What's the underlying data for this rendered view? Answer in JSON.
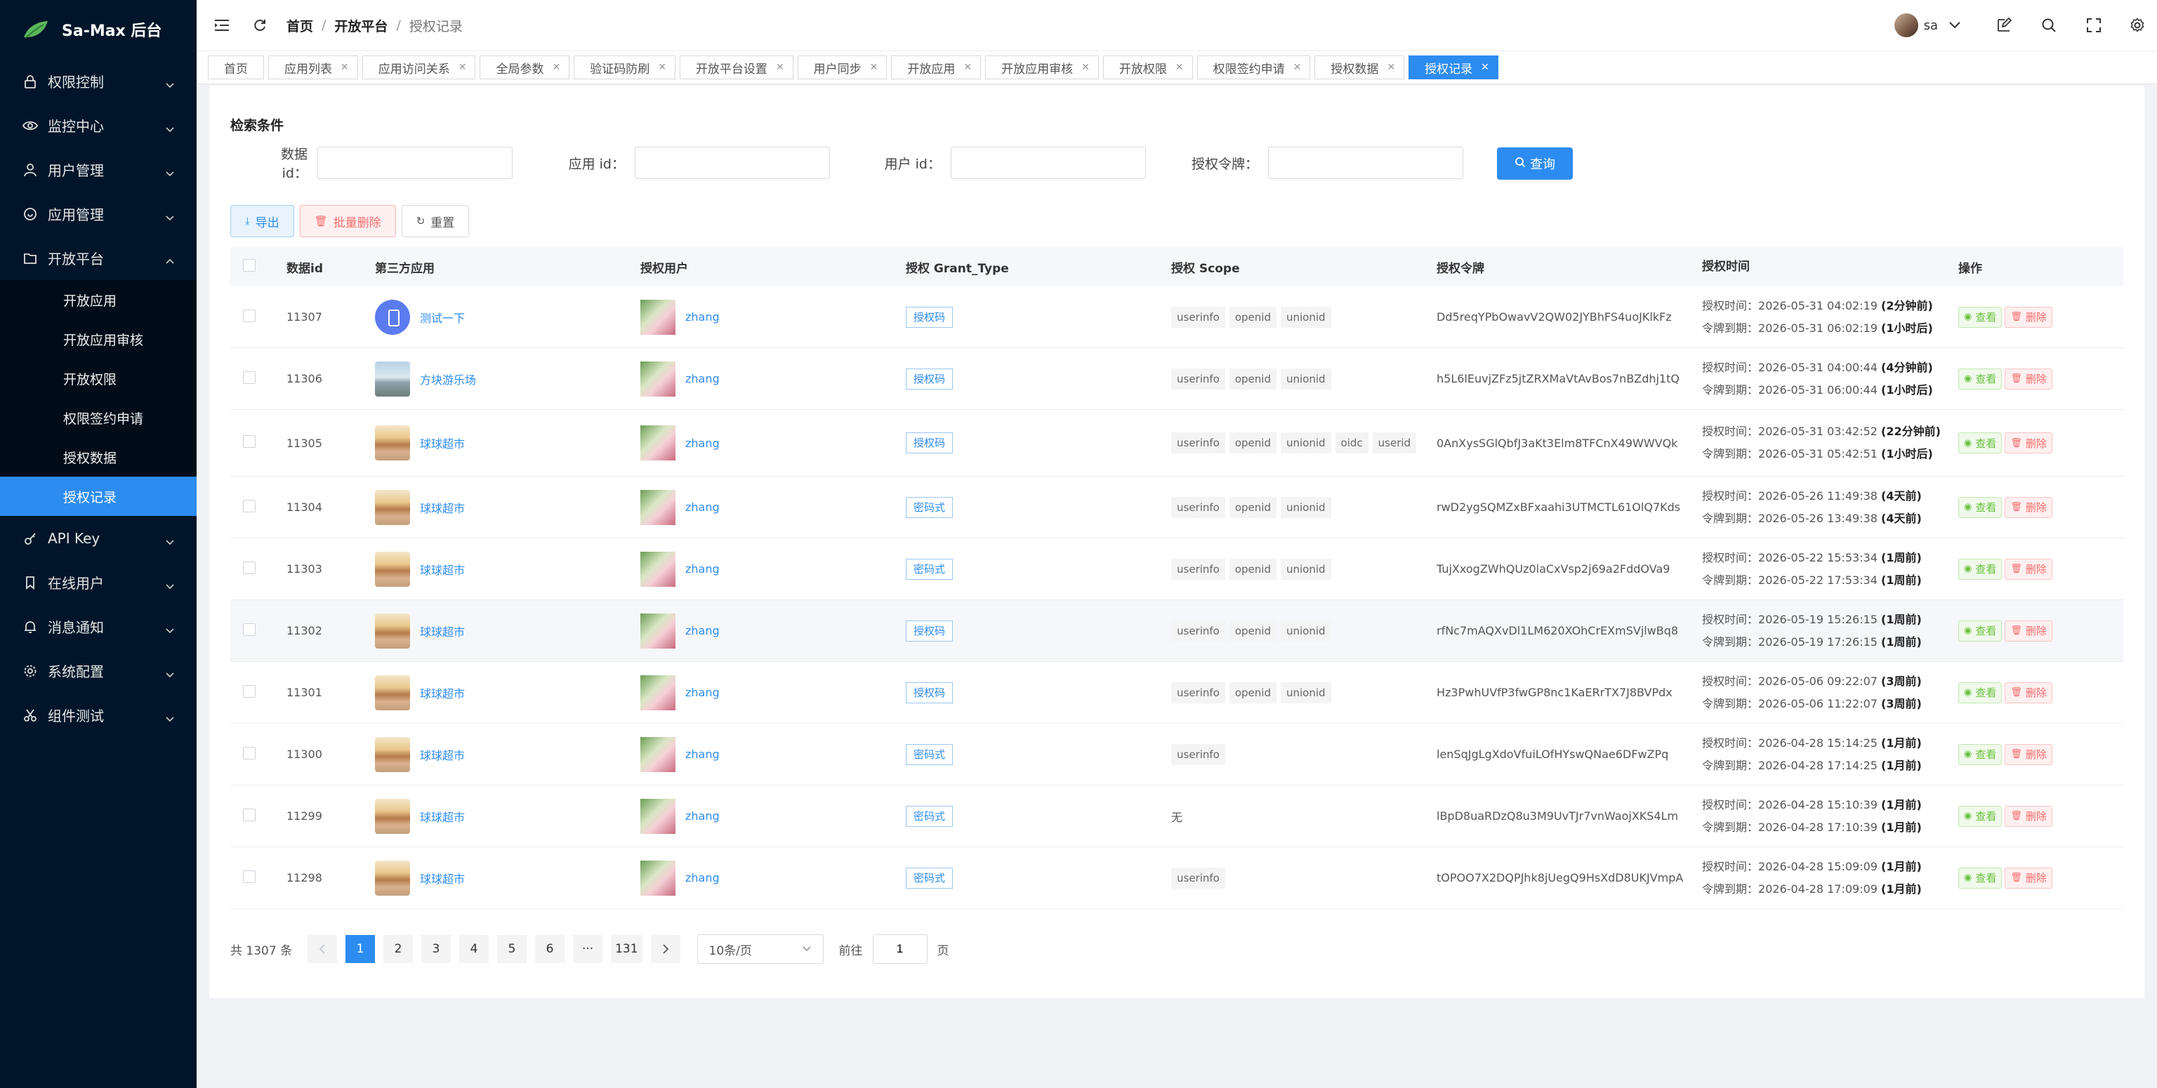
{
  "app": {
    "title": "Sa-Max 后台",
    "accent": "#2d8cf0",
    "sidebar_bg": "#001529"
  },
  "sidebar": {
    "groups": [
      {
        "label": "权限控制",
        "icon": "lock-icon",
        "expanded": false
      },
      {
        "label": "监控中心",
        "icon": "eye-icon",
        "expanded": false
      },
      {
        "label": "用户管理",
        "icon": "user-icon",
        "expanded": false
      },
      {
        "label": "应用管理",
        "icon": "app-icon",
        "expanded": false
      },
      {
        "label": "开放平台",
        "icon": "folder-icon",
        "expanded": true,
        "items": [
          {
            "label": "开放应用",
            "active": false
          },
          {
            "label": "开放应用审核",
            "active": false
          },
          {
            "label": "开放权限",
            "active": false
          },
          {
            "label": "权限签约申请",
            "active": false
          },
          {
            "label": "授权数据",
            "active": false
          },
          {
            "label": "授权记录",
            "active": true
          }
        ]
      },
      {
        "label": "API Key",
        "icon": "key-icon",
        "expanded": false
      },
      {
        "label": "在线用户",
        "icon": "bookmark-icon",
        "expanded": false
      },
      {
        "label": "消息通知",
        "icon": "bell-icon",
        "expanded": false
      },
      {
        "label": "系统配置",
        "icon": "gear-icon",
        "expanded": false
      },
      {
        "label": "组件测试",
        "icon": "scissors-icon",
        "expanded": false
      }
    ]
  },
  "header": {
    "breadcrumb": [
      "首页",
      "开放平台",
      "授权记录"
    ],
    "user": "sa"
  },
  "tabs": [
    {
      "label": "首页",
      "closable": false,
      "active": false
    },
    {
      "label": "应用列表",
      "closable": true,
      "active": false
    },
    {
      "label": "应用访问关系",
      "closable": true,
      "active": false
    },
    {
      "label": "全局参数",
      "closable": true,
      "active": false
    },
    {
      "label": "验证码防刷",
      "closable": true,
      "active": false
    },
    {
      "label": "开放平台设置",
      "closable": true,
      "active": false
    },
    {
      "label": "用户同步",
      "closable": true,
      "active": false
    },
    {
      "label": "开放应用",
      "closable": true,
      "active": false
    },
    {
      "label": "开放应用审核",
      "closable": true,
      "active": false
    },
    {
      "label": "开放权限",
      "closable": true,
      "active": false
    },
    {
      "label": "权限签约申请",
      "closable": true,
      "active": false
    },
    {
      "label": "授权数据",
      "closable": true,
      "active": false
    },
    {
      "label": "授权记录",
      "closable": true,
      "active": true
    }
  ],
  "search": {
    "title": "检索条件",
    "fields": [
      {
        "label": "数据 id：",
        "value": ""
      },
      {
        "label": "应用 id：",
        "value": ""
      },
      {
        "label": "用户 id：",
        "value": ""
      },
      {
        "label": "授权令牌：",
        "value": ""
      }
    ],
    "query_label": "查询"
  },
  "toolbar": {
    "export": "导出",
    "batch_delete": "批量删除",
    "reset": "重置"
  },
  "table": {
    "columns": [
      "数据id",
      "第三方应用",
      "授权用户",
      "授权 Grant_Type",
      "授权 Scope",
      "授权令牌",
      "授权时间",
      "操作"
    ],
    "time_labels": {
      "auth": "授权时间：",
      "expire": "令牌到期："
    },
    "actions": {
      "view": "查看",
      "delete": "删除"
    },
    "rows": [
      {
        "id": "11307",
        "app": "测试一下",
        "app_logo": "phone",
        "user": "zhang",
        "grant": "授权码",
        "scopes": [
          "userinfo",
          "openid",
          "unionid"
        ],
        "token": "Dd5reqYPbOwavV2QW02JYBhFS4uoJKlkFz",
        "auth_time": "2026-05-31 04:02:19",
        "auth_rel": "(2分钟前)",
        "expire_time": "2026-05-31 06:02:19",
        "expire_rel": "(1小时后)"
      },
      {
        "id": "11306",
        "app": "方块游乐场",
        "app_logo": "square",
        "user": "zhang",
        "grant": "授权码",
        "scopes": [
          "userinfo",
          "openid",
          "unionid"
        ],
        "token": "h5L6lEuvjZFz5jtZRXMaVtAvBos7nBZdhj1tQ",
        "auth_time": "2026-05-31 04:00:44",
        "auth_rel": "(4分钟前)",
        "expire_time": "2026-05-31 06:00:44",
        "expire_rel": "(1小时后)"
      },
      {
        "id": "11305",
        "app": "球球超市",
        "app_logo": "ball",
        "user": "zhang",
        "grant": "授权码",
        "scopes": [
          "userinfo",
          "openid",
          "unionid",
          "oidc",
          "userid"
        ],
        "token": "0AnXysSGlQbfJ3aKt3Elm8TFCnX49WWVQk",
        "auth_time": "2026-05-31 03:42:52",
        "auth_rel": "(22分钟前)",
        "expire_time": "2026-05-31 05:42:51",
        "expire_rel": "(1小时后)"
      },
      {
        "id": "11304",
        "app": "球球超市",
        "app_logo": "ball",
        "user": "zhang",
        "grant": "密码式",
        "scopes": [
          "userinfo",
          "openid",
          "unionid"
        ],
        "token": "rwD2ygSQMZxBFxaahi3UTMCTL61OlQ7Kds",
        "auth_time": "2026-05-26 11:49:38",
        "auth_rel": "(4天前)",
        "expire_time": "2026-05-26 13:49:38",
        "expire_rel": "(4天前)"
      },
      {
        "id": "11303",
        "app": "球球超市",
        "app_logo": "ball",
        "user": "zhang",
        "grant": "密码式",
        "scopes": [
          "userinfo",
          "openid",
          "unionid"
        ],
        "token": "TujXxogZWhQUz0laCxVsp2j69a2FddOVa9",
        "auth_time": "2026-05-22 15:53:34",
        "auth_rel": "(1周前)",
        "expire_time": "2026-05-22 17:53:34",
        "expire_rel": "(1周前)"
      },
      {
        "id": "11302",
        "app": "球球超市",
        "app_logo": "ball",
        "user": "zhang",
        "grant": "授权码",
        "scopes": [
          "userinfo",
          "openid",
          "unionid"
        ],
        "token": "rfNc7mAQXvDl1LM620XOhCrEXmSVjlwBq8",
        "auth_time": "2026-05-19 15:26:15",
        "auth_rel": "(1周前)",
        "expire_time": "2026-05-19 17:26:15",
        "expire_rel": "(1周前)",
        "highlight": true
      },
      {
        "id": "11301",
        "app": "球球超市",
        "app_logo": "ball",
        "user": "zhang",
        "grant": "授权码",
        "scopes": [
          "userinfo",
          "openid",
          "unionid"
        ],
        "token": "Hz3PwhUVfP3fwGP8nc1KaERrTX7J8BVPdx",
        "auth_time": "2026-05-06 09:22:07",
        "auth_rel": "(3周前)",
        "expire_time": "2026-05-06 11:22:07",
        "expire_rel": "(3周前)"
      },
      {
        "id": "11300",
        "app": "球球超市",
        "app_logo": "ball",
        "user": "zhang",
        "grant": "密码式",
        "scopes": [
          "userinfo"
        ],
        "token": "lenSqJgLgXdoVfuiLOfHYswQNae6DFwZPq",
        "auth_time": "2026-04-28 15:14:25",
        "auth_rel": "(1月前)",
        "expire_time": "2026-04-28 17:14:25",
        "expire_rel": "(1月前)"
      },
      {
        "id": "11299",
        "app": "球球超市",
        "app_logo": "ball",
        "user": "zhang",
        "grant": "密码式",
        "scopes": [],
        "scope_empty": "无",
        "token": "lBpD8uaRDzQ8u3M9UvTJr7vnWaojXKS4Lm",
        "auth_time": "2026-04-28 15:10:39",
        "auth_rel": "(1月前)",
        "expire_time": "2026-04-28 17:10:39",
        "expire_rel": "(1月前)"
      },
      {
        "id": "11298",
        "app": "球球超市",
        "app_logo": "ball",
        "user": "zhang",
        "grant": "密码式",
        "scopes": [
          "userinfo"
        ],
        "token": "tOPOO7X2DQPJhk8jUegQ9HsXdD8UKJVmpA",
        "auth_time": "2026-04-28 15:09:09",
        "auth_rel": "(1月前)",
        "expire_time": "2026-04-28 17:09:09",
        "expire_rel": "(1月前)"
      }
    ]
  },
  "pagination": {
    "total_text": "共 1307 条",
    "pages": [
      "1",
      "2",
      "3",
      "4",
      "5",
      "6",
      "···",
      "131"
    ],
    "current": "1",
    "page_size": "10条/页",
    "goto_label": "前往",
    "goto_value": "1",
    "page_suffix": "页"
  }
}
